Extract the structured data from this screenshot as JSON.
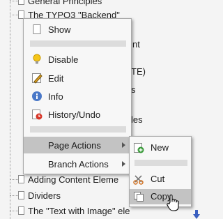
{
  "tree": {
    "rows": [
      {
        "label": "General Principles"
      },
      {
        "label": "The TYPO3 \"Backend\""
      },
      {
        "label": "Adding Content Eleme"
      },
      {
        "label": "Dividers"
      },
      {
        "label": "The \"Text with Image\" ele"
      }
    ],
    "partials": [
      "nt",
      "TE)",
      "s",
      "les"
    ]
  },
  "context_menu": {
    "items": [
      {
        "label": "Show"
      },
      {
        "label": "Disable"
      },
      {
        "label": "Edit"
      },
      {
        "label": "Info"
      },
      {
        "label": "History/Undo"
      },
      {
        "label": "Page Actions"
      },
      {
        "label": "Branch Actions"
      }
    ]
  },
  "page_actions_submenu": {
    "items": [
      {
        "label": "New"
      },
      {
        "label": "Cut"
      },
      {
        "label": "Copy"
      }
    ]
  },
  "colors": {
    "menu_bg": "#f7f7f7",
    "highlight": "#c3c3c3",
    "separator": "#dcdcdc"
  }
}
